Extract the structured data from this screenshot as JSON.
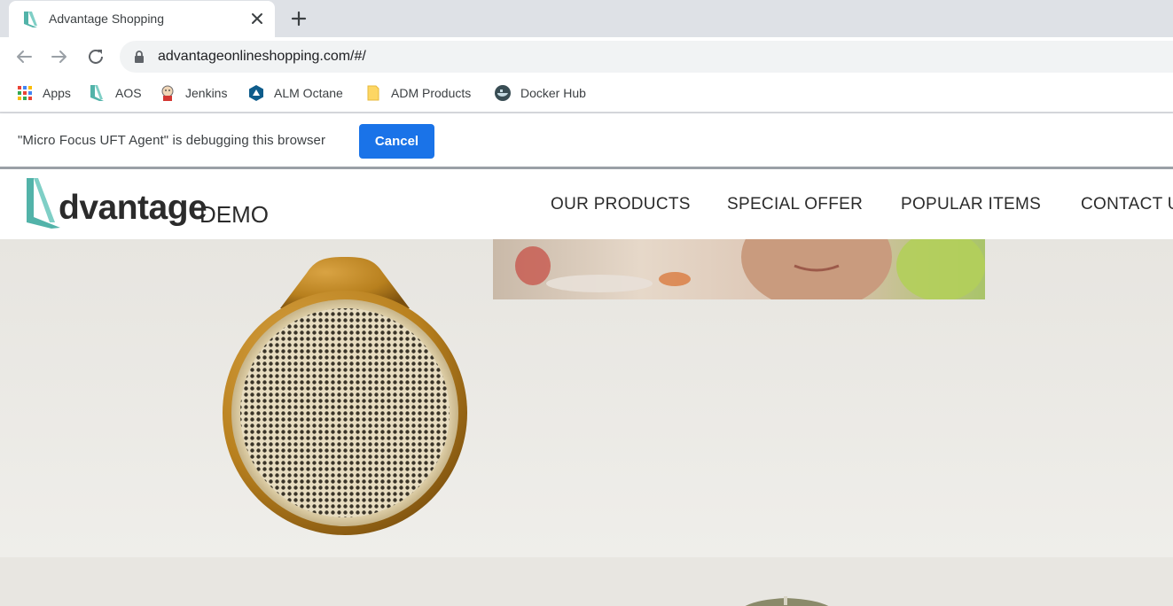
{
  "browser": {
    "tab": {
      "title": "Advantage Shopping",
      "favicon": "aos-logo-icon"
    },
    "url": "advantageonlineshopping.com/#/",
    "bookmarks": [
      {
        "label": "Apps",
        "icon": "apps-grid-icon"
      },
      {
        "label": "AOS",
        "icon": "aos-logo-icon"
      },
      {
        "label": "Jenkins",
        "icon": "jenkins-icon"
      },
      {
        "label": "ALM Octane",
        "icon": "octane-icon"
      },
      {
        "label": "ADM Products",
        "icon": "folder-icon"
      },
      {
        "label": "Docker Hub",
        "icon": "docker-icon"
      }
    ]
  },
  "debug_bar": {
    "message": "\"Micro Focus UFT Agent\" is debugging this browser",
    "cancel_label": "Cancel"
  },
  "site": {
    "logo": {
      "word": "dvantage",
      "suffix": "DEMO"
    },
    "nav": [
      {
        "label": "OUR PRODUCTS"
      },
      {
        "label": "SPECIAL OFFER"
      },
      {
        "label": "POPULAR ITEMS"
      },
      {
        "label": "CONTACT US"
      }
    ]
  },
  "colors": {
    "accent_teal": "#52b3a9",
    "button_blue": "#1a73e8",
    "speaker_gold": "#b8801e"
  }
}
